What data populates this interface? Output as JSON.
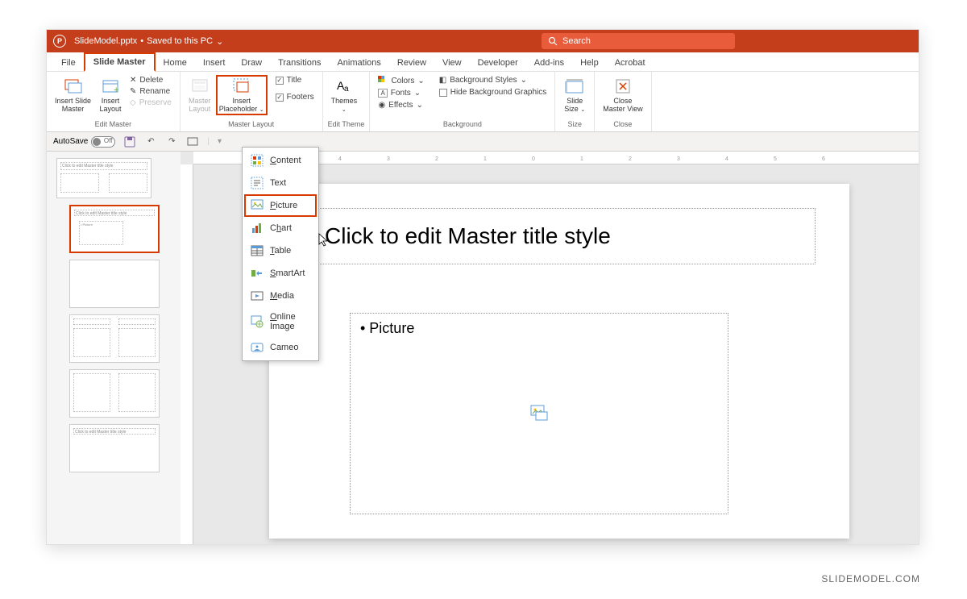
{
  "titlebar": {
    "filename": "SlideModel.pptx",
    "saved_status": "Saved to this PC",
    "search_placeholder": "Search"
  },
  "tabs": [
    "File",
    "Slide Master",
    "Home",
    "Insert",
    "Draw",
    "Transitions",
    "Animations",
    "Review",
    "View",
    "Developer",
    "Add-ins",
    "Help",
    "Acrobat"
  ],
  "ribbon": {
    "edit_master": {
      "label": "Edit Master",
      "insert_slide_master": "Insert Slide\nMaster",
      "insert_layout": "Insert\nLayout",
      "delete": "Delete",
      "rename": "Rename",
      "preserve": "Preserve"
    },
    "master_layout": {
      "label": "Master Layout",
      "master_layout_btn": "Master\nLayout",
      "insert_placeholder": "Insert\nPlaceholder",
      "title_cb": "Title",
      "footers_cb": "Footers"
    },
    "edit_theme": {
      "label": "Edit Theme",
      "themes": "Themes"
    },
    "background": {
      "label": "Background",
      "colors": "Colors",
      "fonts": "Fonts",
      "effects": "Effects",
      "bg_styles": "Background Styles",
      "hide_bg": "Hide Background Graphics"
    },
    "size": {
      "label": "Size",
      "slide_size": "Slide\nSize"
    },
    "close": {
      "label": "Close",
      "close_master": "Close\nMaster View"
    }
  },
  "qat": {
    "autosave": "AutoSave"
  },
  "dropdown": {
    "items": [
      {
        "label": "Content",
        "accel": "C"
      },
      {
        "label": "Text",
        "accel": ""
      },
      {
        "label": "Picture",
        "accel": "P"
      },
      {
        "label": "Chart",
        "accel": "H"
      },
      {
        "label": "Table",
        "accel": "T"
      },
      {
        "label": "SmartArt",
        "accel": "S"
      },
      {
        "label": "Media",
        "accel": "M"
      },
      {
        "label": "Online Image",
        "accel": "O"
      },
      {
        "label": "Cameo",
        "accel": ""
      }
    ]
  },
  "slide": {
    "title_text": "Click to edit Master title style",
    "picture_label": "• Picture"
  },
  "thumb_text": "Click to edit Master title style",
  "watermark": "SLIDEMODEL.COM"
}
